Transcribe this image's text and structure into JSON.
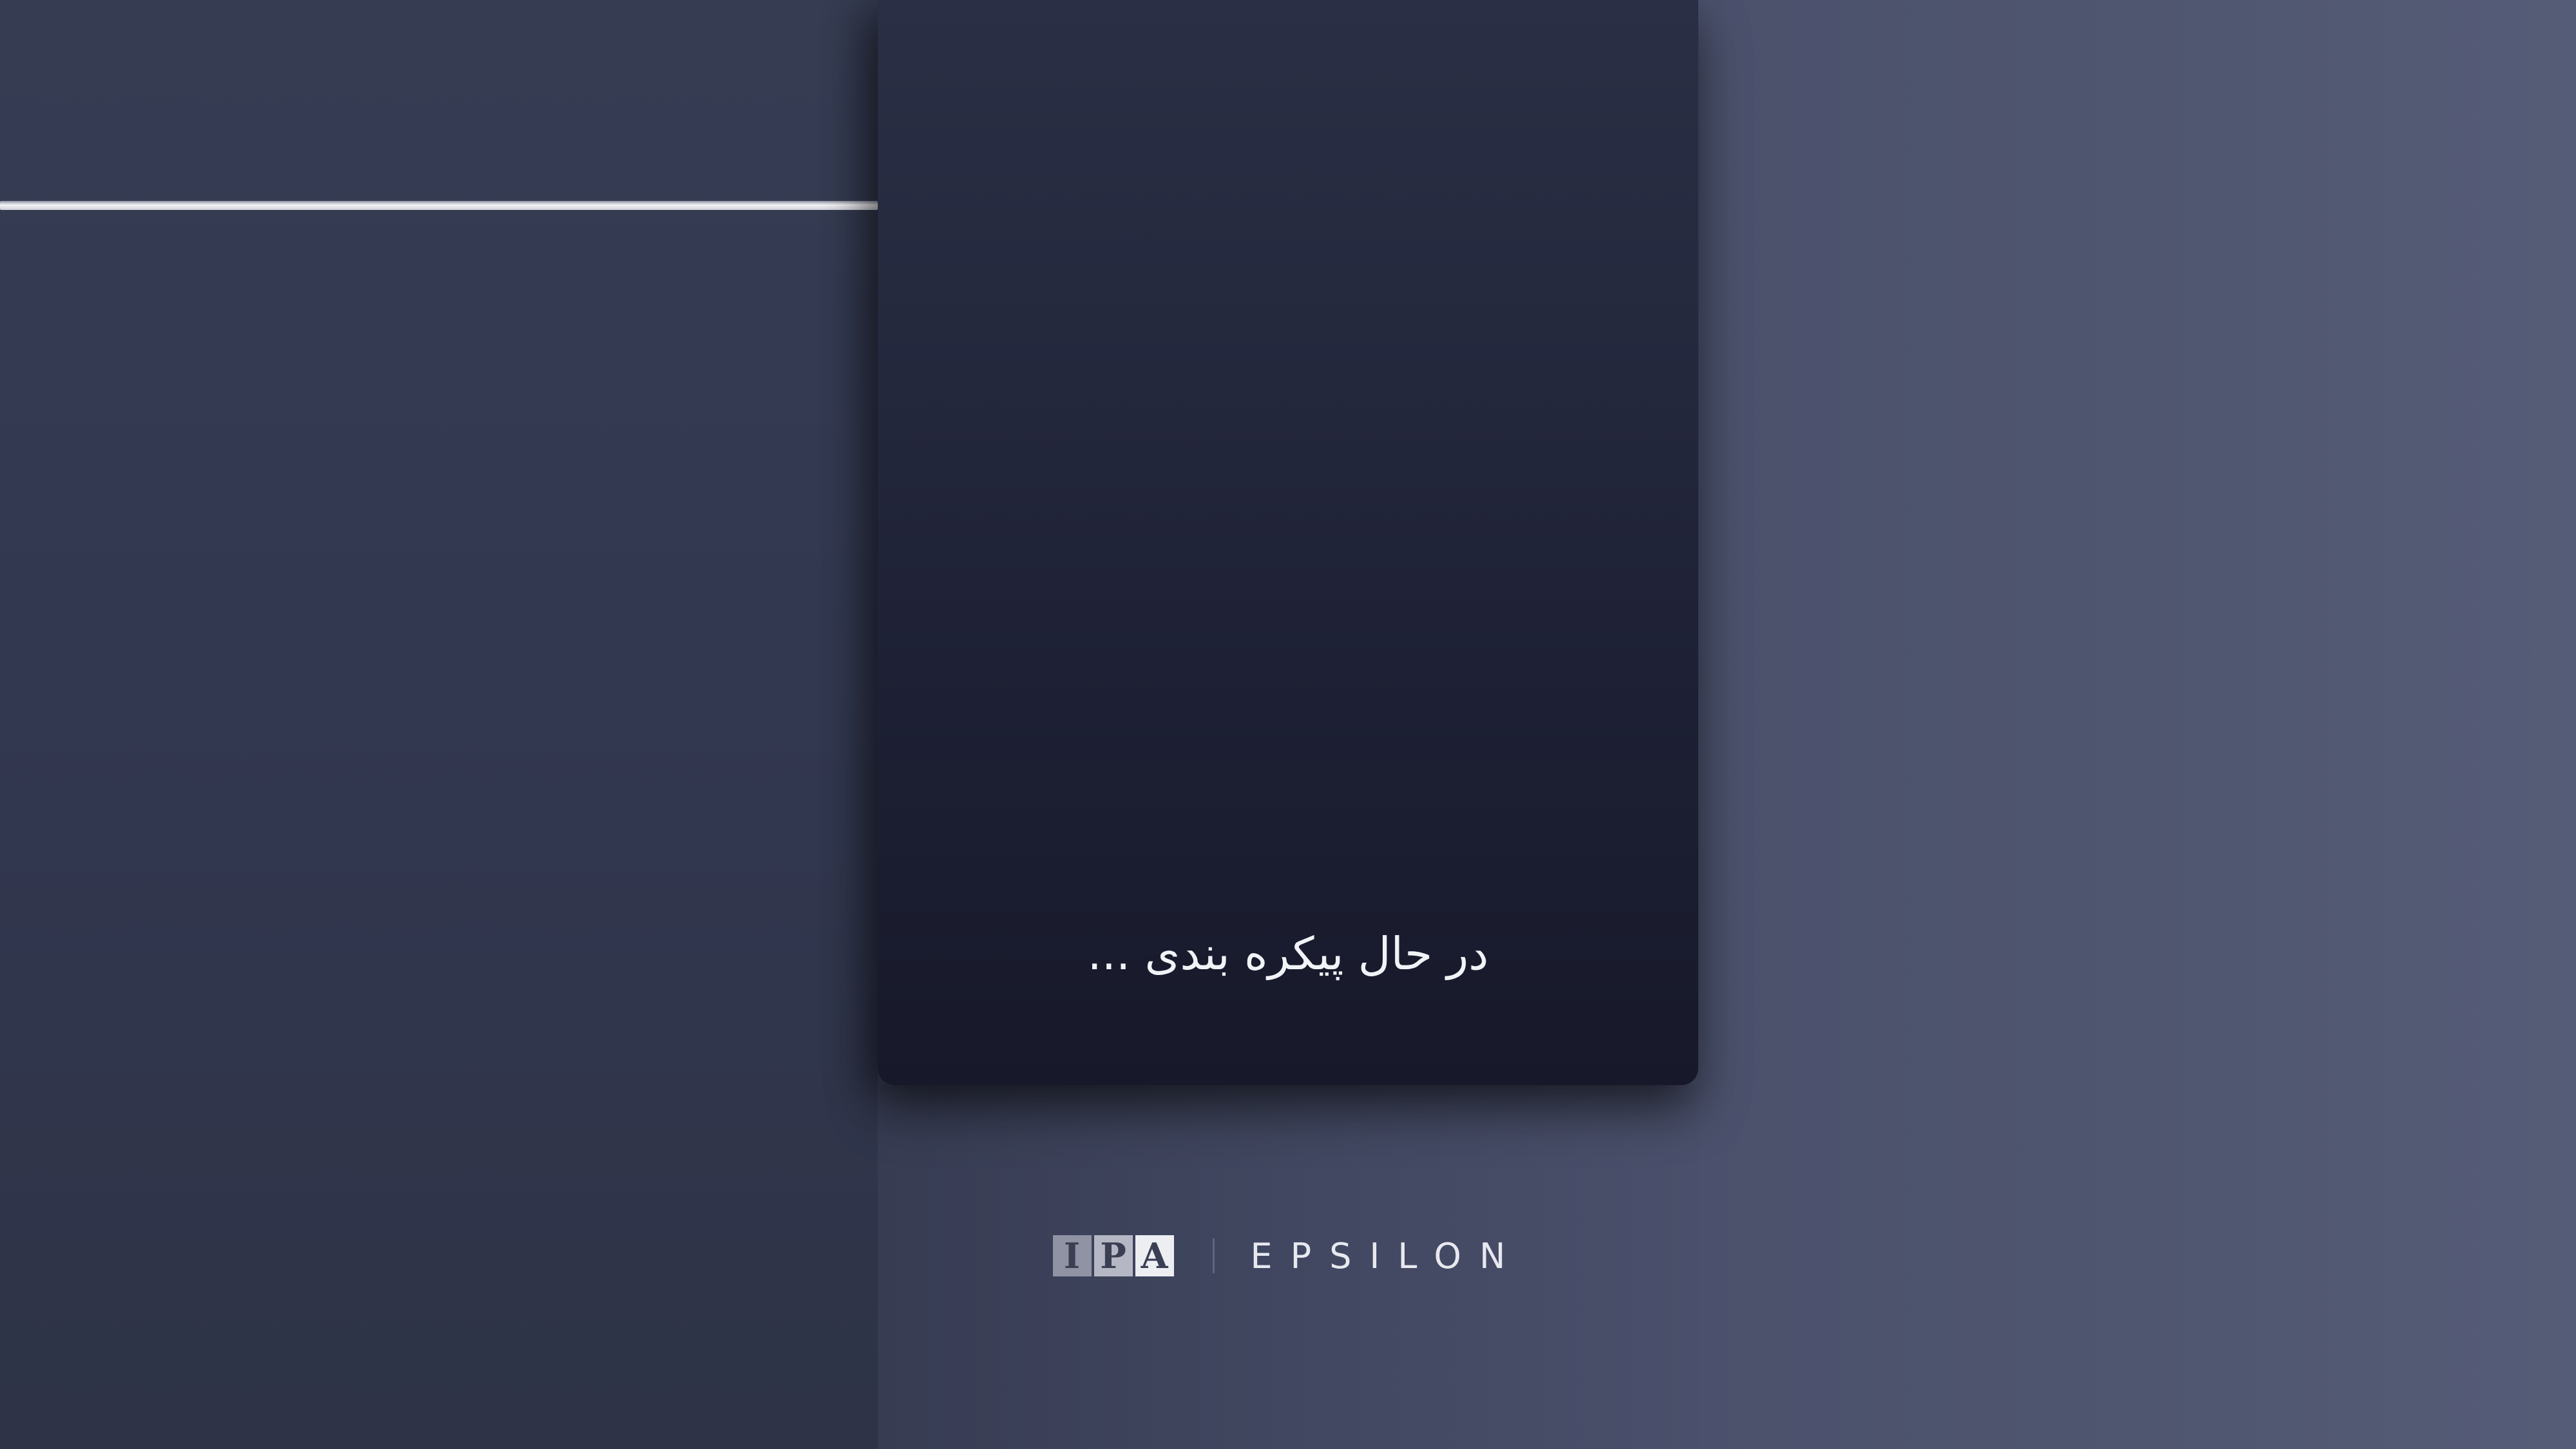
{
  "status": {
    "loading_text": "در حال پیکره بندی ...",
    "progress": 1.0
  },
  "brand": {
    "logo_letters": [
      "I",
      "P",
      "A"
    ],
    "product_name": "EPSILON"
  },
  "colors": {
    "card_top": "#2a2f45",
    "card_bottom": "#17192a",
    "progress_bar": "#f2f2f4",
    "text": "#f2f3f7"
  }
}
